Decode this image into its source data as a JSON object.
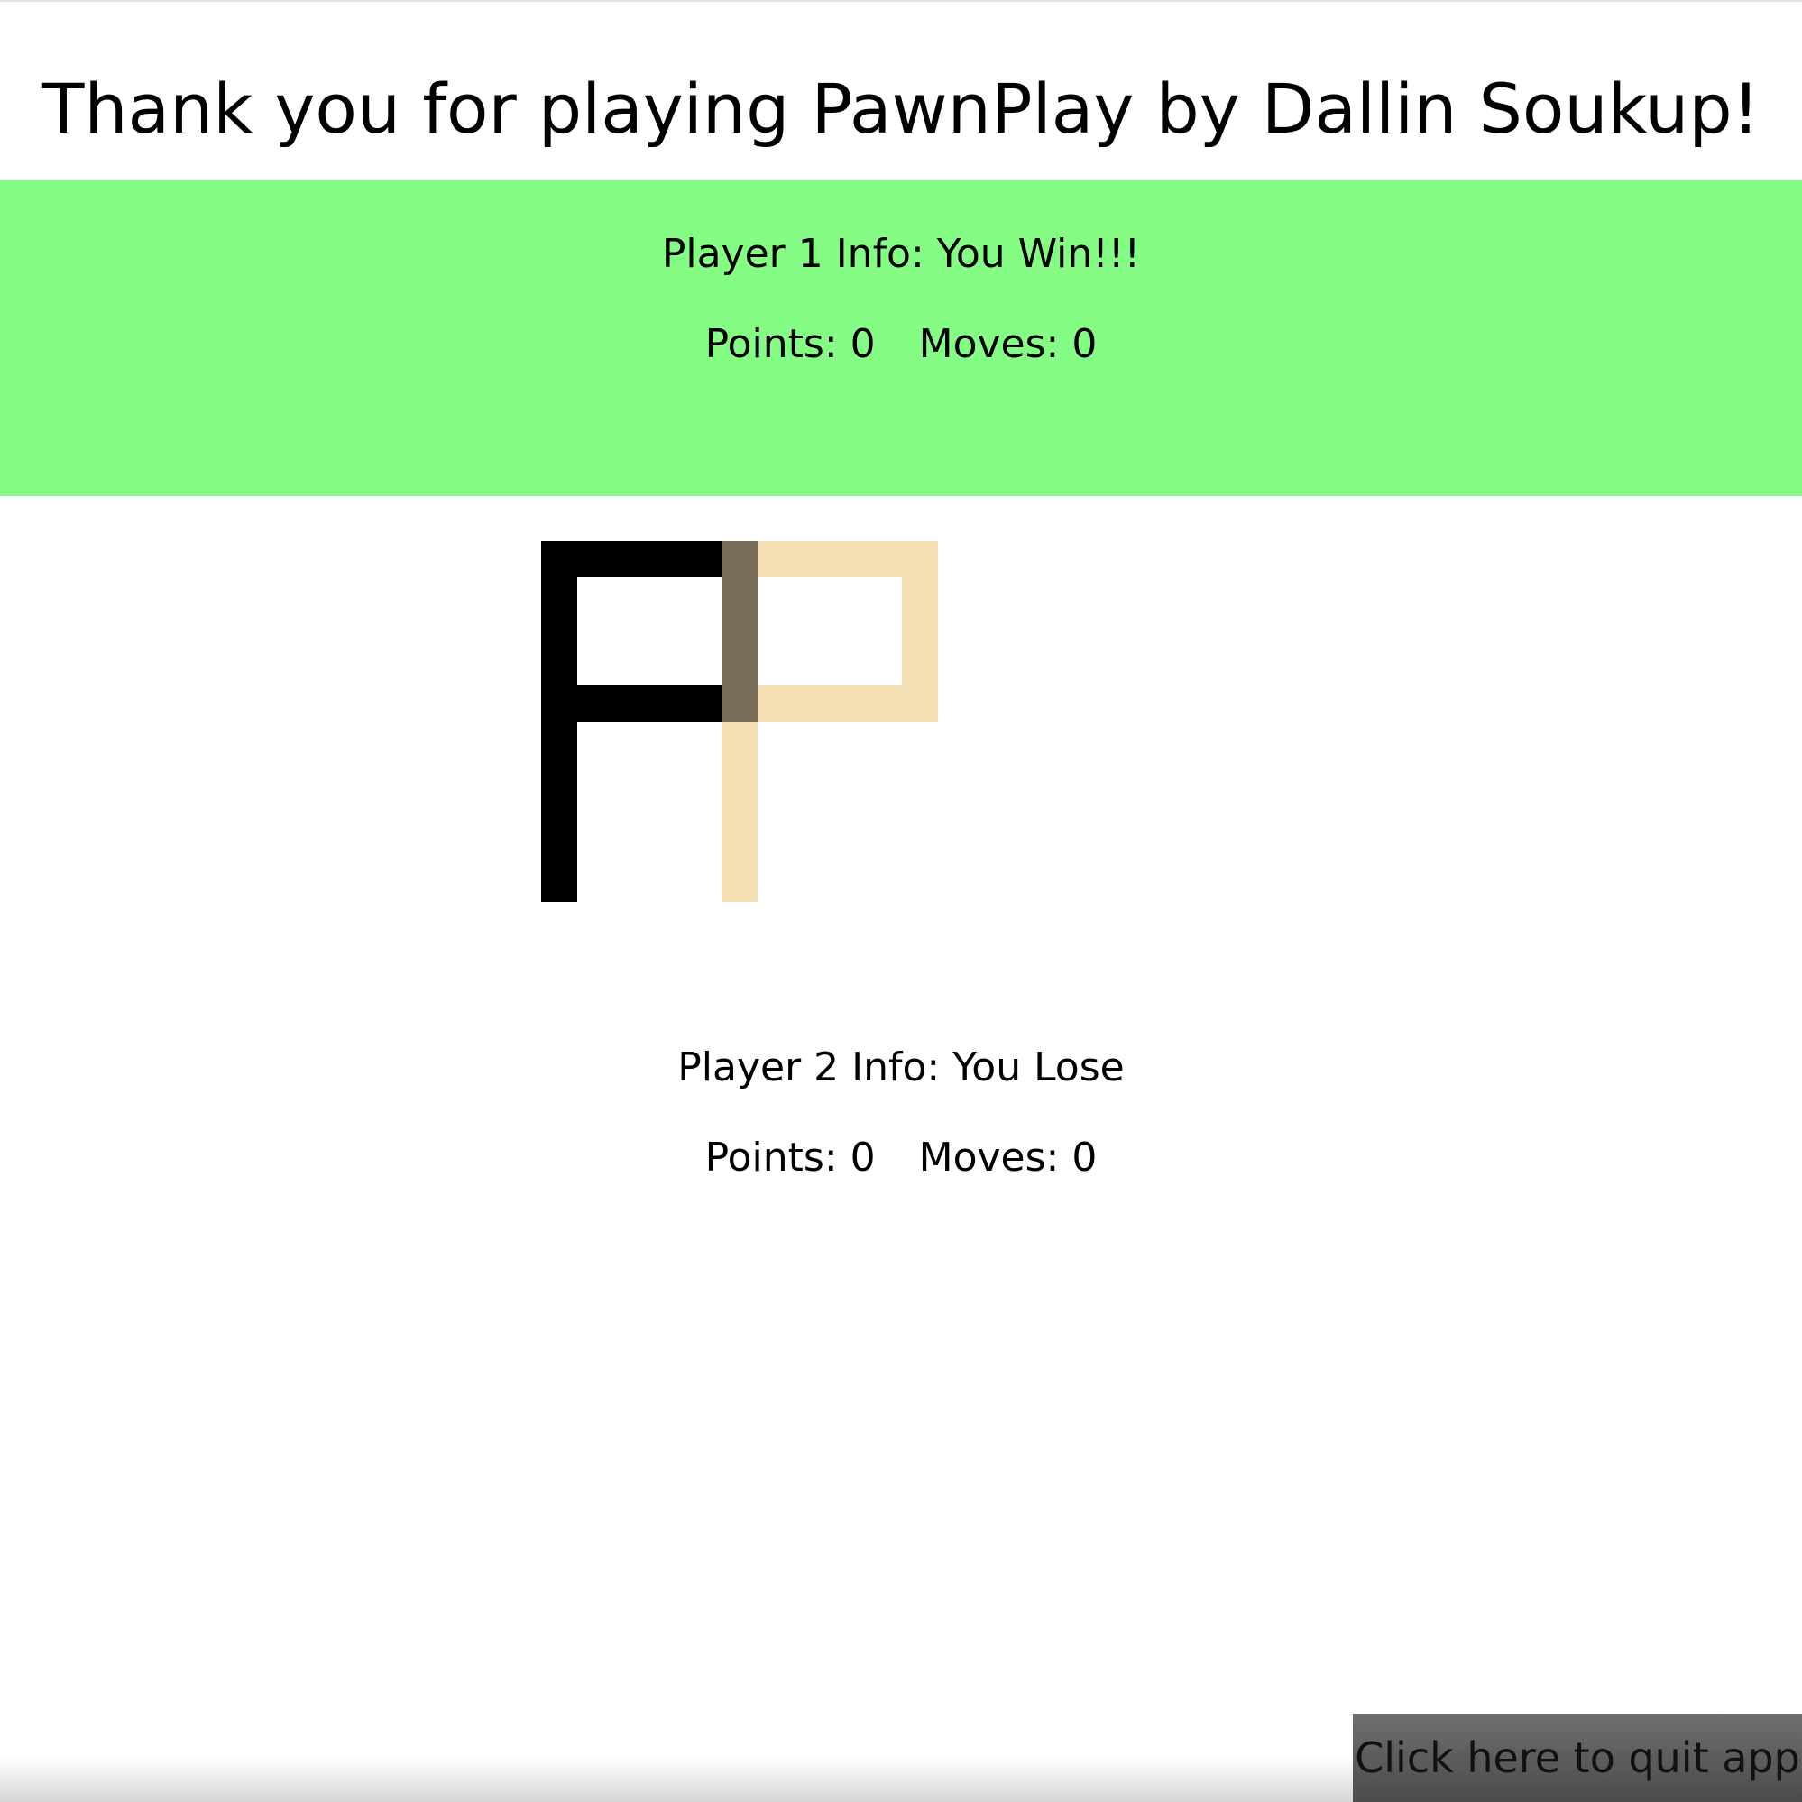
{
  "header": {
    "title": "Thank you for playing PawnPlay by Dallin Soukup!"
  },
  "players": [
    {
      "info_text": "Player 1 Info: You Win!!!",
      "points_text": "Points: 0",
      "moves_text": "Moves: 0",
      "panel_color": "#85fd85"
    },
    {
      "info_text": "Player 2 Info: You Lose",
      "points_text": "Points: 0",
      "moves_text": "Moves: 0",
      "panel_color": "#ffffff"
    }
  ],
  "board": {
    "piece_colors": {
      "player1": "#000000",
      "player2": "#f4deb3",
      "overlap": "#7a6d57"
    }
  },
  "quit_button": {
    "label": "Click here to quit app"
  }
}
